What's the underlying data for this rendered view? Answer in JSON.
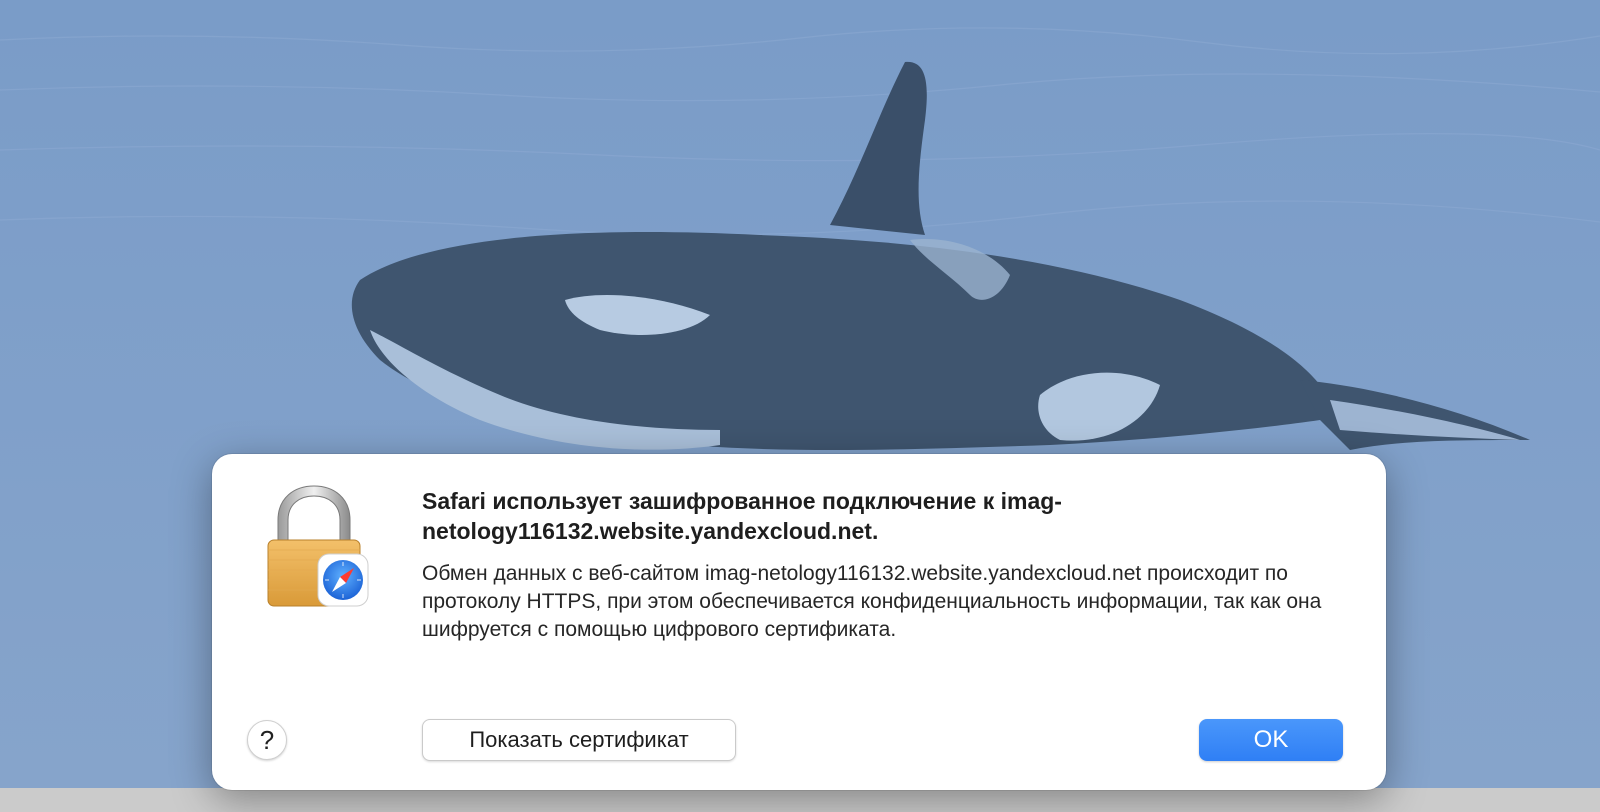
{
  "dialog": {
    "title": "Safari использует зашифрованное подключение к imag-netology116132.website.yandexcloud.net.",
    "message": "Обмен данных с веб-сайтом imag-netology116132.website.yandexcloud.net происходит по протоколу HTTPS, при этом обеспечивается конфиденциальность информации, так как она шифруется с помощью цифрового сертификата.",
    "help_label": "?",
    "show_certificate_label": "Показать сертификат",
    "ok_label": "OK",
    "icon": "lock-with-safari-compass-icon"
  },
  "background": {
    "image": "orca-underwater-photo"
  },
  "colors": {
    "accent": "#2f7ff5",
    "backdrop": "#7d9ec9",
    "dialog_bg": "#ffffff"
  }
}
